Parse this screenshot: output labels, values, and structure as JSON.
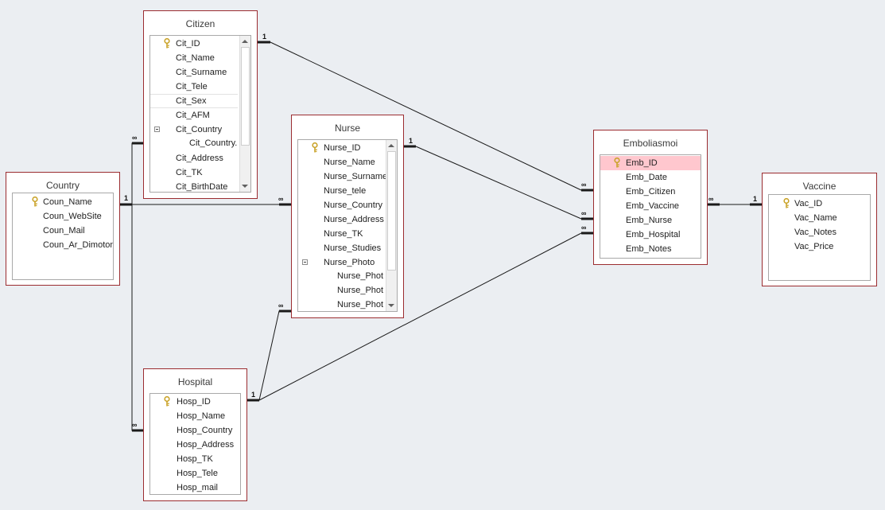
{
  "tables": {
    "citizen": {
      "title": "Citizen",
      "fields": [
        "Cit_ID",
        "Cit_Name",
        "Cit_Surname",
        "Cit_Tele",
        "Cit_Sex",
        "Cit_AFM",
        "Cit_Country",
        "Cit_Country.",
        "Cit_Address",
        "Cit_TK",
        "Cit_BirthDate"
      ]
    },
    "country": {
      "title": "Country",
      "fields": [
        "Coun_Name",
        "Coun_WebSite",
        "Coun_Mail",
        "Coun_Ar_Dimoton"
      ]
    },
    "nurse": {
      "title": "Nurse",
      "fields": [
        "Nurse_ID",
        "Nurse_Name",
        "Nurse_Surname",
        "Nurse_tele",
        "Nurse_Country",
        "Nurse_Address",
        "Nurse_TK",
        "Nurse_Studies",
        "Nurse_Photo",
        "Nurse_Phot",
        "Nurse_Phot",
        "Nurse_Phot"
      ]
    },
    "hospital": {
      "title": "Hospital",
      "fields": [
        "Hosp_ID",
        "Hosp_Name",
        "Hosp_Country",
        "Hosp_Address",
        "Hosp_TK",
        "Hosp_Tele",
        "Hosp_mail"
      ]
    },
    "emboliasmoi": {
      "title": "Emboliasmoi",
      "fields": [
        "Emb_ID",
        "Emb_Date",
        "Emb_Citizen",
        "Emb_Vaccine",
        "Emb_Nurse",
        "Emb_Hospital",
        "Emb_Notes"
      ]
    },
    "vaccine": {
      "title": "Vaccine",
      "fields": [
        "Vac_ID",
        "Vac_Name",
        "Vac_Notes",
        "Vac_Price"
      ]
    }
  },
  "relationships": [
    {
      "from": "Country",
      "to": "Citizen",
      "one": "1",
      "many": "∞"
    },
    {
      "from": "Country",
      "to": "Nurse",
      "one": "1",
      "many": "∞"
    },
    {
      "from": "Country",
      "to": "Hospital",
      "one": "1",
      "many": "∞"
    },
    {
      "from": "Citizen",
      "to": "Emboliasmoi",
      "one": "1",
      "many": "∞"
    },
    {
      "from": "Nurse",
      "to": "Emboliasmoi",
      "one": "1",
      "many": "∞"
    },
    {
      "from": "Hospital",
      "to": "Emboliasmoi",
      "one": "1",
      "many": "∞"
    },
    {
      "from": "Hospital",
      "to": "Nurse",
      "one": "1",
      "many": "∞"
    },
    {
      "from": "Vaccine",
      "to": "Emboliasmoi",
      "one": "1",
      "many": "∞"
    }
  ],
  "colors": {
    "canvas": "#ebeef2",
    "table_border": "#9b2c30",
    "selected_row": "#ffc7ce",
    "line": "#1a1a1a",
    "key_icon": "#c9a227"
  }
}
